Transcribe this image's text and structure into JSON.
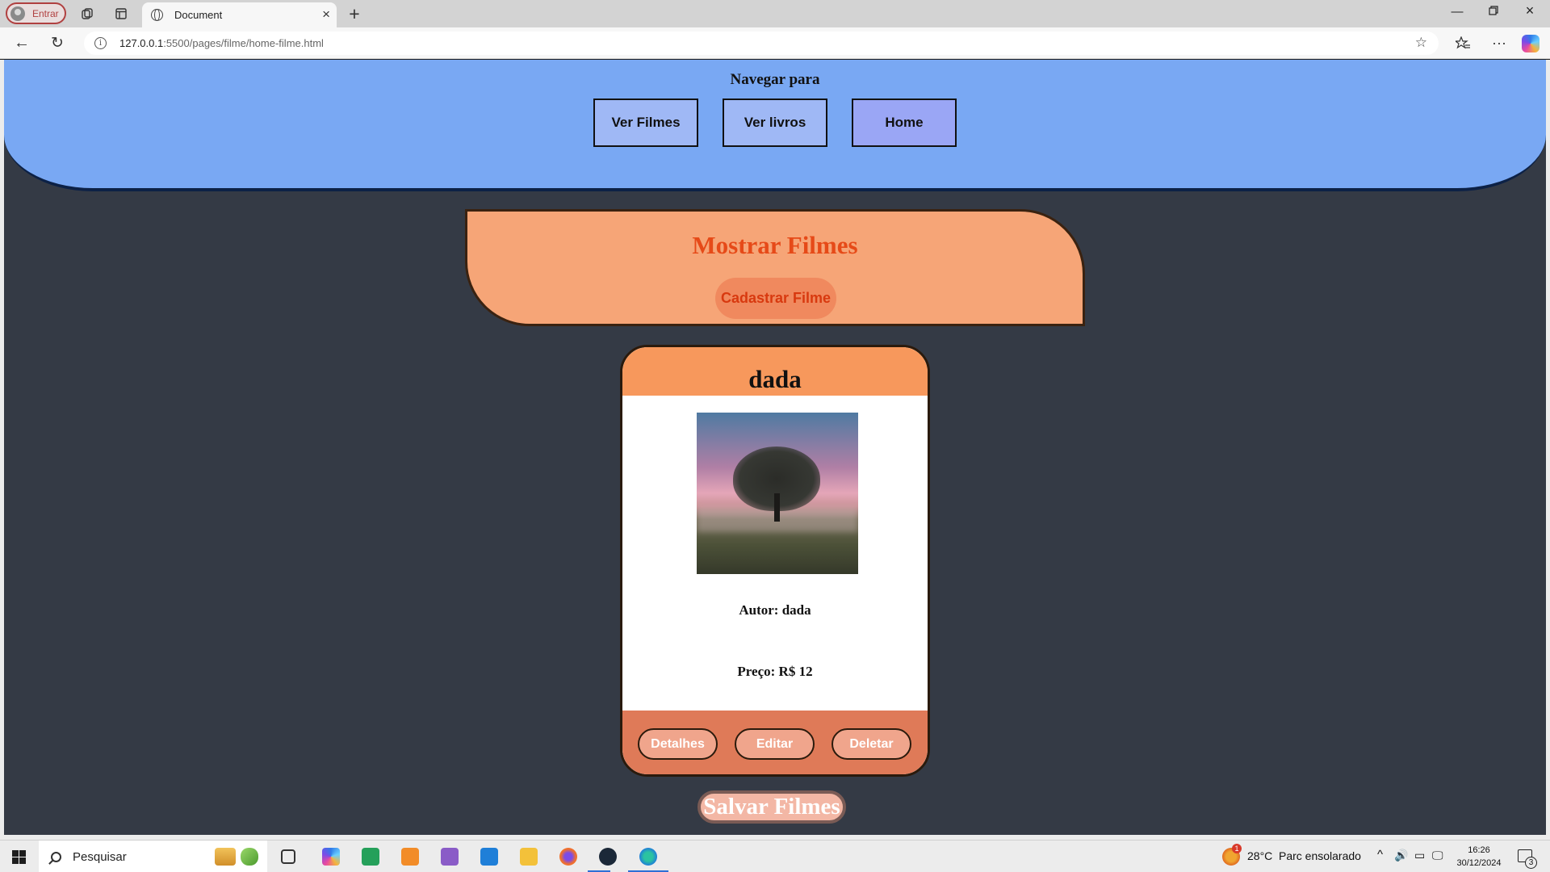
{
  "browser": {
    "profile_label": "Entrar",
    "tab_title": "Document",
    "url_host": "127.0.0.1",
    "url_rest": ":5500/pages/filme/home-filme.html"
  },
  "nav": {
    "title": "Navegar para",
    "links": [
      "Ver Filmes",
      "Ver livros",
      "Home"
    ]
  },
  "panel": {
    "title": "Mostrar Filmes",
    "register_button": "Cadastrar Filme"
  },
  "card": {
    "title": "dada",
    "author_text": "Autor: dada",
    "price_text": "Preço: R$ 12",
    "buttons": [
      "Detalhes",
      "Editar",
      "Deletar"
    ],
    "image_alt": "tree-landscape-image"
  },
  "save_button": "Salvar Filmes",
  "taskbar": {
    "search_placeholder": "Pesquisar",
    "weather": "28°C",
    "weather_desc": "Parc ensolarado",
    "time": "16:26",
    "date": "30/12/2024",
    "notification_count": "3",
    "weather_badge": "1"
  },
  "colors": {
    "nav_bg": "#79a8f3",
    "page_bg": "#343a45",
    "panel_bg": "#f6a577",
    "accent_text": "#e64a18",
    "card_head": "#f7985c",
    "card_foot": "#df7a58"
  }
}
